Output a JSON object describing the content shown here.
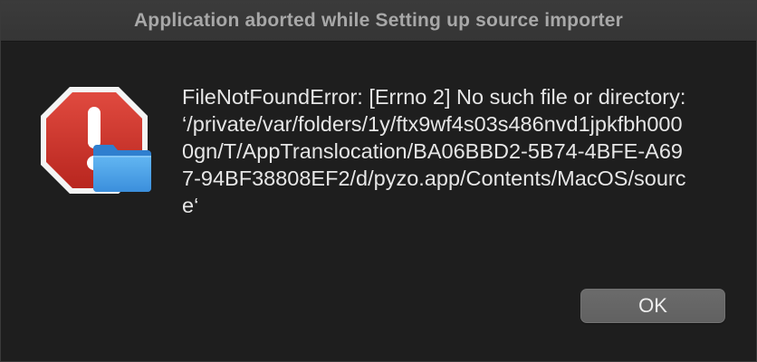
{
  "window": {
    "title": "Application aborted while Setting up source importer"
  },
  "alert": {
    "icon": "stop-alert-with-folder-icon",
    "message": "FileNotFoundError: [Errno 2] No such file or directory: ‘/private/var/folders/1y/ftx9wf4s03s486nvd1jpkfbh0000gn/T/AppTranslocation/BA06BBD2-5B74-4BFE-A697-94BF38808EF2/d/pyzo.app/Contents/MacOS/source‘"
  },
  "buttons": {
    "ok_label": "OK"
  },
  "colors": {
    "background": "#1e1e1e",
    "titlebar": "#383838",
    "alert_red": "#d0342c",
    "folder_blue": "#4aa3ea",
    "button": "#666666"
  }
}
